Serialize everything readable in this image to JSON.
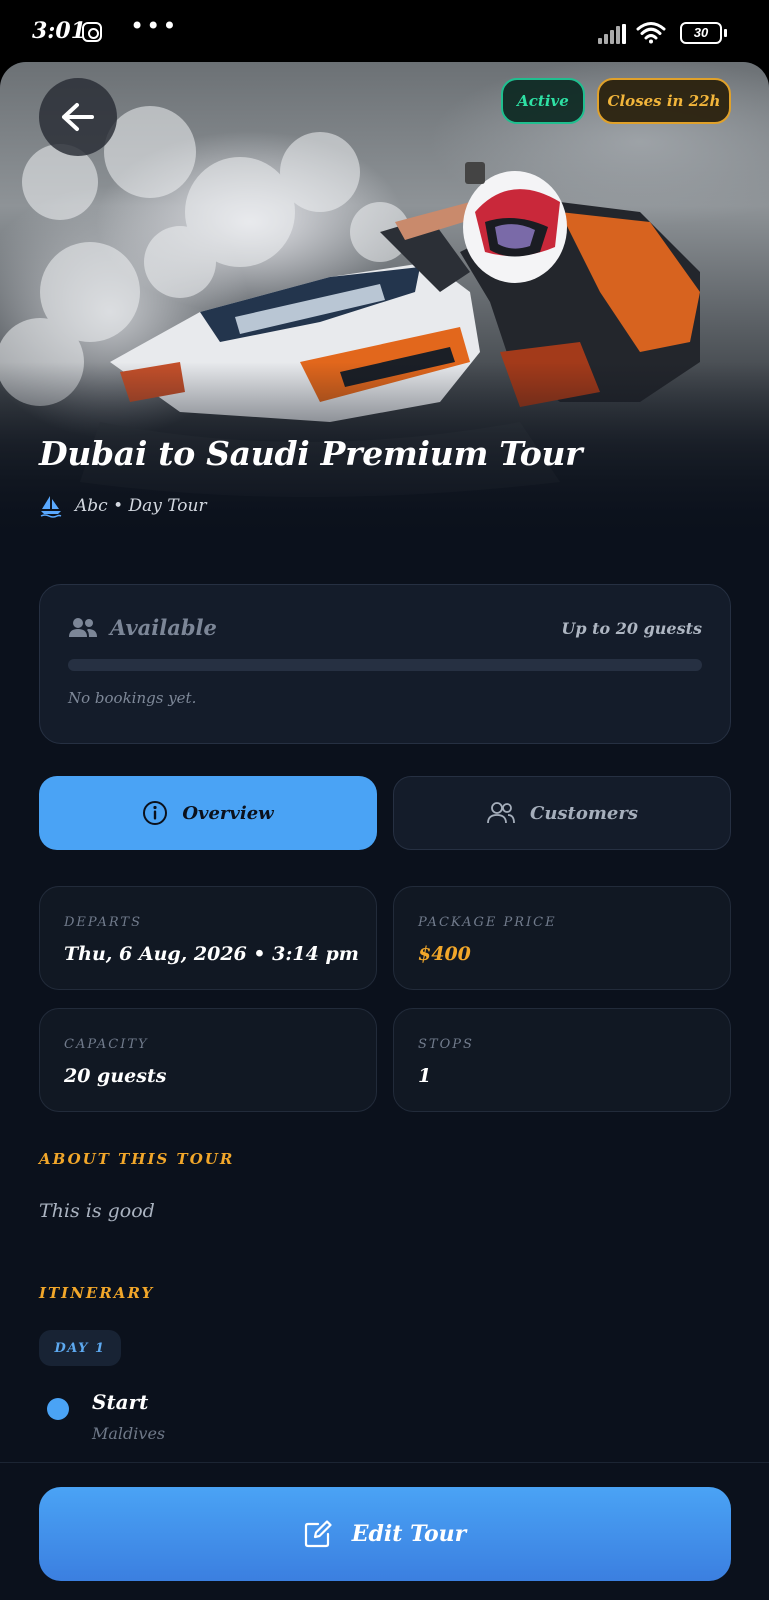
{
  "status_bar": {
    "time": "3:01",
    "more": "•••",
    "battery": "30",
    "icons": [
      "instagram-icon",
      "signal-icon",
      "wifi-icon",
      "battery-icon"
    ]
  },
  "hero": {
    "status_badge": "Active",
    "closes_badge": "Closes in 22h",
    "title": "Dubai to Saudi Premium Tour",
    "subtitle": "Abc • Day Tour",
    "image": "jet-ski-rider-photo"
  },
  "availability": {
    "label": "Available",
    "capacity_text": "Up to 20 guests",
    "booked_fraction": 0,
    "note": "No bookings yet."
  },
  "tabs": [
    {
      "label": "Overview",
      "icon": "info-icon",
      "active": true
    },
    {
      "label": "Customers",
      "icon": "users-icon",
      "active": false
    }
  ],
  "details": {
    "departs_label": "DEPARTS",
    "departs_value": "Thu, 6 Aug, 2026 • 3:14 pm",
    "price_label": "PACKAGE PRICE",
    "price_value": "$400",
    "capacity_label": "CAPACITY",
    "capacity_value": "20 guests",
    "stops_label": "STOPS",
    "stops_value": "1"
  },
  "about": {
    "heading": "ABOUT THIS TOUR",
    "text": "This is good"
  },
  "itinerary": {
    "heading": "ITINERARY",
    "day_label": "DAY 1",
    "stops": [
      {
        "name": "Start",
        "place": "Maldives"
      }
    ]
  },
  "footer": {
    "edit_label": "Edit Tour"
  },
  "colors": {
    "accent": "#4aa3f5",
    "background": "#0b111c",
    "active_green": "#2ee0a4",
    "warning_amber": "#f2a72a"
  }
}
